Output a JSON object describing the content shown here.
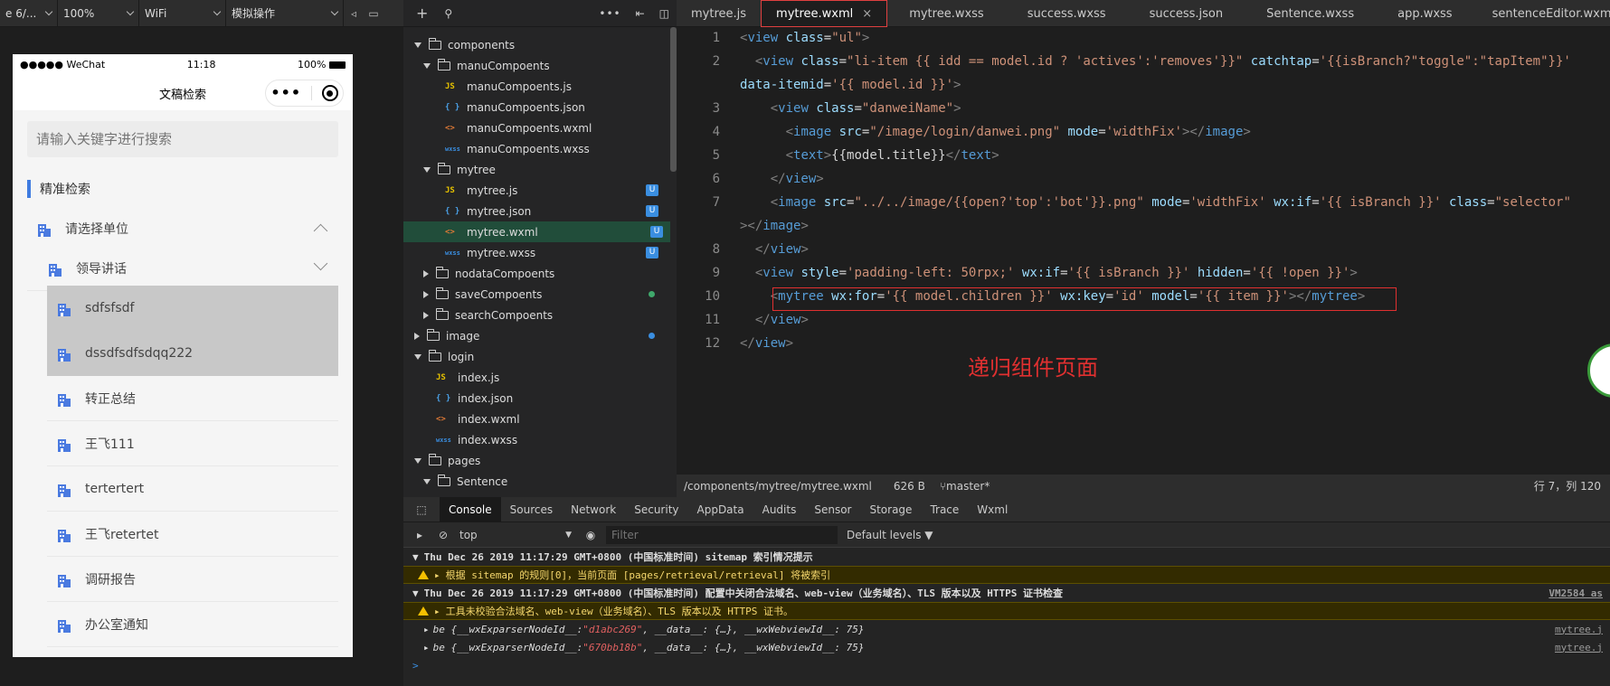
{
  "toolbar": {
    "device": "e 6/...",
    "zoom": "100%",
    "network": "WiFi",
    "mode": "模拟操作"
  },
  "phone": {
    "status_left": "●●●●● WeChat",
    "time": "11:18",
    "battery": "100%",
    "title": "文稿检索",
    "search_placeholder": "请输入关键字进行搜索",
    "section_title": "精准检索",
    "rows": [
      {
        "label": "请选择单位"
      },
      {
        "label": "领导讲话"
      },
      {
        "label": "sdfsfsdf"
      },
      {
        "label": "dssdfsdfsdqq222"
      },
      {
        "label": "转正总结"
      },
      {
        "label": "王飞111"
      },
      {
        "label": "tertertert"
      },
      {
        "label": "王飞retertet"
      },
      {
        "label": "调研报告"
      },
      {
        "label": "办公室通知"
      }
    ],
    "accent": "#3f7be0"
  },
  "filetree": {
    "items": [
      {
        "label": "components",
        "badge": ""
      },
      {
        "label": "manuCompoents",
        "badge": ""
      },
      {
        "label": "manuCompoents.js",
        "badge": ""
      },
      {
        "label": "manuCompoents.json",
        "badge": ""
      },
      {
        "label": "manuCompoents.wxml",
        "badge": ""
      },
      {
        "label": "manuCompoents.wxss",
        "badge": ""
      },
      {
        "label": "mytree",
        "badge": ""
      },
      {
        "label": "mytree.js",
        "badge": "U"
      },
      {
        "label": "mytree.json",
        "badge": "U"
      },
      {
        "label": "mytree.wxml",
        "badge": "U"
      },
      {
        "label": "mytree.wxss",
        "badge": "U"
      },
      {
        "label": "nodataCompoents",
        "badge": ""
      },
      {
        "label": "saveCompoents",
        "badge": ""
      },
      {
        "label": "searchCompoents",
        "badge": ""
      },
      {
        "label": "image",
        "badge": ""
      },
      {
        "label": "login",
        "badge": ""
      },
      {
        "label": "index.js",
        "badge": ""
      },
      {
        "label": "index.json",
        "badge": ""
      },
      {
        "label": "index.wxml",
        "badge": ""
      },
      {
        "label": "index.wxss",
        "badge": ""
      },
      {
        "label": "pages",
        "badge": ""
      },
      {
        "label": "Sentence",
        "badge": ""
      }
    ]
  },
  "tabs": [
    "mytree.js",
    "mytree.wxml",
    "mytree.wxss",
    "success.wxss",
    "success.json",
    "Sentence.wxss",
    "app.wxss",
    "sentenceEditor.wxml"
  ],
  "tab_close": "×",
  "editor": {
    "line_numbers": [
      "1",
      "2",
      "",
      "3",
      "4",
      "5",
      "6",
      "7",
      "",
      "8",
      "9",
      "10",
      "11",
      "12"
    ],
    "annotation": "递归组件页面"
  },
  "statusbar": {
    "path": "/components/mytree/mytree.wxml",
    "size": "626 B",
    "branch": "master*",
    "cursor": "行 7，列 120"
  },
  "devtools": {
    "tabs": [
      "Console",
      "Sources",
      "Network",
      "Security",
      "AppData",
      "Audits",
      "Sensor",
      "Storage",
      "Trace",
      "Wxml"
    ],
    "context": "top",
    "filter_placeholder": "Filter",
    "levels": "Default levels ▼",
    "log1_header": "Thu Dec 26 2019 11:17:29 GMT+0800 (中国标准时间) sitemap 索引情况提示",
    "log1_warn": "根据 sitemap 的规则[0]，当前页面 [pages/retrieval/retrieval] 将被索引",
    "log2_header": "Thu Dec 26 2019 11:17:29 GMT+0800 (中国标准时间) 配置中关闭合法域名、web-view（业务域名）、TLS 版本以及 HTTPS 证书检查",
    "log2_src": "VM2584 as",
    "log2_warn": "工具未校验合法域名、web-view（业务域名）、TLS 版本以及 HTTPS 证书。",
    "obj1_pre": "be {__wxExparserNodeId__: ",
    "obj1_id": "\"d1abc269\"",
    "obj1_post": ", __data__: {…}, __wxWebviewId__: 75}",
    "obj1_src": "mytree.j",
    "obj2_pre": "be {__wxExparserNodeId__: ",
    "obj2_id": "\"670bb18b\"",
    "obj2_post": ", __data__: {…}, __wxWebviewId__: 75}",
    "obj2_src": "mytree.j",
    "prompt": ">"
  }
}
